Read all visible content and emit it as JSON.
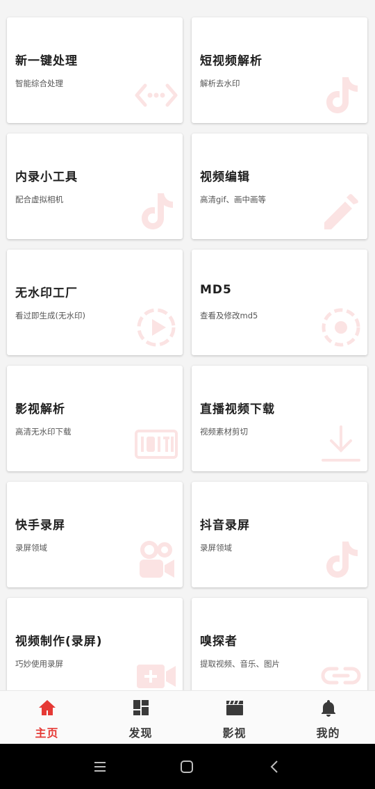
{
  "cards": [
    {
      "title": "新一键处理",
      "subtitle": "智能综合处理",
      "icon": "code-icon"
    },
    {
      "title": "短视频解析",
      "subtitle": "解析去水印",
      "icon": "tiktok-icon"
    },
    {
      "title": "内录小工具",
      "subtitle": "配合虚拟相机",
      "icon": "tiktok-icon"
    },
    {
      "title": "视频编辑",
      "subtitle": "高清gif、画中画等",
      "icon": "pencil-icon"
    },
    {
      "title": "无水印工厂",
      "subtitle": "看过即生成(无水印)",
      "icon": "play-circle-icon"
    },
    {
      "title": "MD5",
      "subtitle": "查看及修改md5",
      "icon": "target-icon"
    },
    {
      "title": "影视解析",
      "subtitle": "高清无水印下载",
      "icon": "iqiyi-icon"
    },
    {
      "title": "直播视频下载",
      "subtitle": "视频素材剪切",
      "icon": "download-icon"
    },
    {
      "title": "快手录屏",
      "subtitle": "录屏领域",
      "icon": "kuaishou-icon"
    },
    {
      "title": "抖音录屏",
      "subtitle": "录屏领域",
      "icon": "tiktok-icon"
    },
    {
      "title": "视频制作(录屏)",
      "subtitle": "巧妙使用录屏",
      "icon": "video-add-icon"
    },
    {
      "title": "嗅探者",
      "subtitle": "提取视频、音乐、图片",
      "icon": "link-icon"
    }
  ],
  "nav": [
    {
      "label": "主页",
      "icon": "home-icon",
      "active": true
    },
    {
      "label": "发现",
      "icon": "dashboard-icon",
      "active": false
    },
    {
      "label": "影视",
      "icon": "clapperboard-icon",
      "active": false
    },
    {
      "label": "我的",
      "icon": "bell-icon",
      "active": false
    }
  ],
  "colors": {
    "accent": "#e53935",
    "icon_watermark": "#fbe3e3",
    "nav_icon": "#3a3a3a",
    "card_bg": "#ffffff",
    "page_bg": "#f4f4f4"
  },
  "system_nav": [
    "menu-icon",
    "home-square-icon",
    "back-icon"
  ]
}
